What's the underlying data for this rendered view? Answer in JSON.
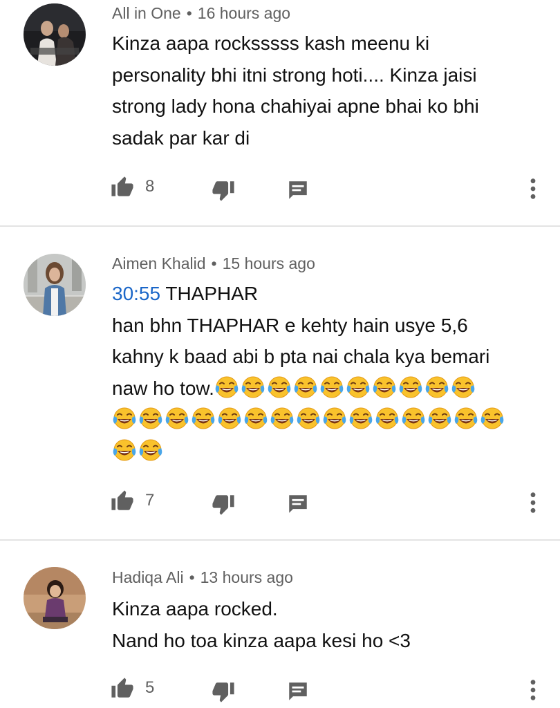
{
  "colors": {
    "timestamp_link": "#1a66c8",
    "meta_text": "#606060",
    "icon": "#606060",
    "divider": "#e3e3e3"
  },
  "icons": {
    "like": "thumbs-up-icon",
    "dislike": "thumbs-down-icon",
    "reply": "reply-comment-icon",
    "menu": "more-vert-icon",
    "emoji": "face-with-tears-of-joy-emoji"
  },
  "comments": [
    {
      "author": "All in One",
      "separator": "•",
      "time": "16 hours ago",
      "lines": [
        "Kinza aapa rocksssss kash meenu ki",
        "personality bhi itni strong hoti.... Kinza jaisi",
        "strong lady hona chahiyai apne bhai ko bhi",
        "sadak par kar di"
      ],
      "likes": "8"
    },
    {
      "author": "Aimen Khalid",
      "separator": "•",
      "time": "15 hours ago",
      "timestamp_link": "30:55",
      "first_line_rest": " THAPHAR",
      "lines": [
        "han bhn THAPHAR e kehty hain usye 5,6",
        "kahny k baad abi b pta nai chala kya bemari",
        "naw ho tow."
      ],
      "emoji_count_line1": 10,
      "emoji_count_line2": 15,
      "emoji_count_line3": 2,
      "likes": "7"
    },
    {
      "author": "Hadiqa Ali",
      "separator": "•",
      "time": "13 hours ago",
      "lines": [
        "Kinza aapa rocked.",
        "Nand ho toa kinza aapa kesi ho <3"
      ],
      "likes": "5"
    }
  ]
}
